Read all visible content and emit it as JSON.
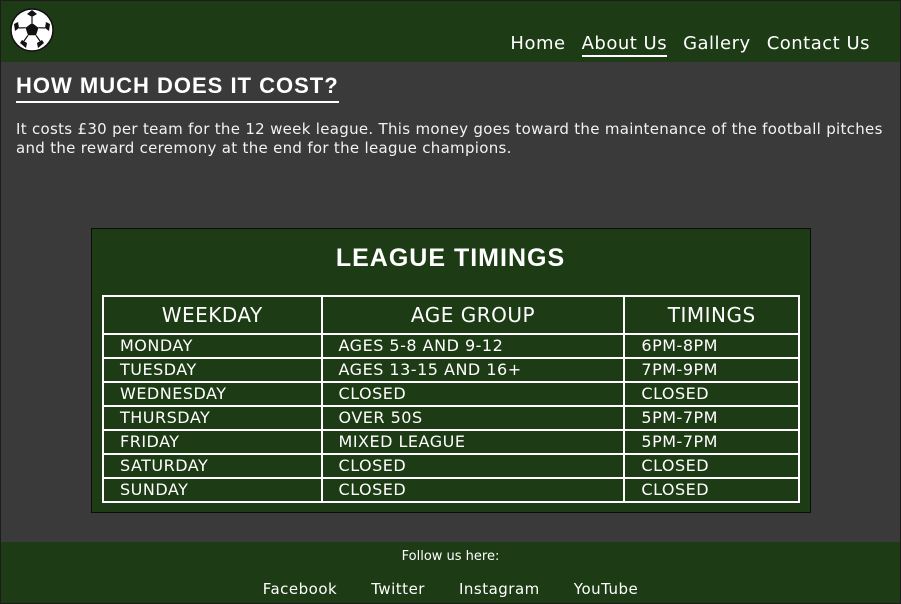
{
  "nav": {
    "items": [
      {
        "label": "Home"
      },
      {
        "label": "About Us"
      },
      {
        "label": "Gallery"
      },
      {
        "label": "Contact Us"
      }
    ],
    "active": "About Us"
  },
  "logo": {
    "icon": "football-icon"
  },
  "cost": {
    "heading": "HOW MUCH DOES IT COST?",
    "text": "It costs £30 per team for the 12 week league. This money goes toward the maintenance of the football pitches and the reward ceremony at the end for the league champions."
  },
  "timings": {
    "title": "LEAGUE TIMINGS",
    "headers": [
      "WEEKDAY",
      "AGE GROUP",
      "TIMINGS"
    ],
    "rows": [
      [
        "MONDAY",
        "AGES 5-8 AND 9-12",
        "6PM-8PM"
      ],
      [
        "TUESDAY",
        "AGES 13-15 AND 16+",
        "7PM-9PM"
      ],
      [
        "WEDNESDAY",
        "CLOSED",
        "CLOSED"
      ],
      [
        "THURSDAY",
        "OVER 50S",
        "5PM-7PM"
      ],
      [
        "FRIDAY",
        "MIXED LEAGUE",
        "5PM-7PM"
      ],
      [
        "SATURDAY",
        "CLOSED",
        "CLOSED"
      ],
      [
        "SUNDAY",
        "CLOSED",
        "CLOSED"
      ]
    ]
  },
  "footer": {
    "follow": "Follow us here:",
    "links": [
      {
        "label": "Facebook"
      },
      {
        "label": "Twitter"
      },
      {
        "label": "Instagram"
      },
      {
        "label": "YouTube"
      }
    ]
  },
  "colors": {
    "header_bg": "#1d3b14",
    "page_bg": "#3a3a3a",
    "text": "#ffffff"
  }
}
